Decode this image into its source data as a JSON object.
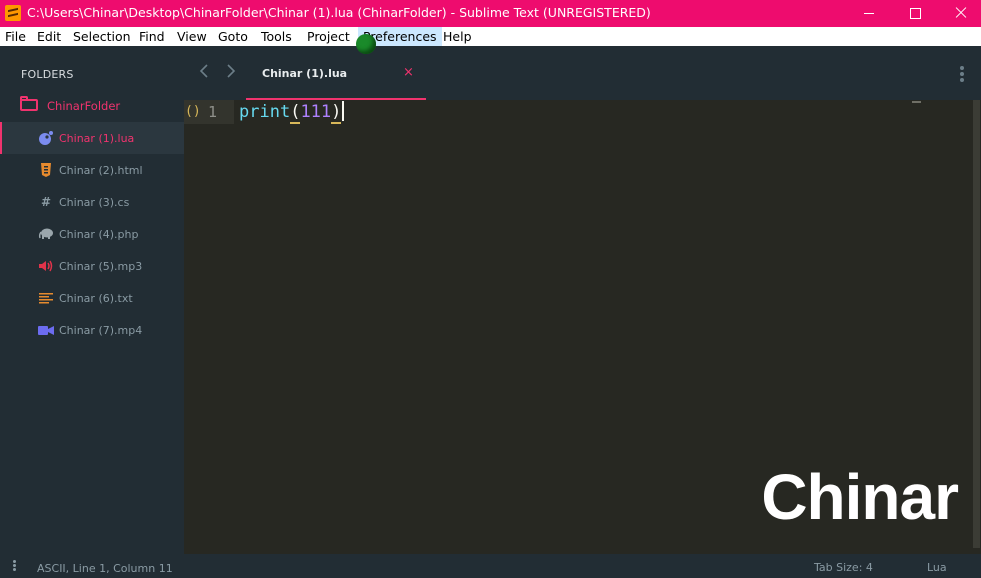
{
  "window": {
    "title": "C:\\Users\\Chinar\\Desktop\\ChinarFolder\\Chinar (1).lua (ChinarFolder) - Sublime Text (UNREGISTERED)"
  },
  "menu": [
    "File",
    "Edit",
    "Selection",
    "Find",
    "View",
    "Goto",
    "Tools",
    "Project",
    "Preferences",
    "Help"
  ],
  "sidebar": {
    "header": "FOLDERS",
    "folder": "ChinarFolder",
    "files": [
      {
        "label": "Chinar (1).lua",
        "icon": "lua-icon",
        "color": "#7b8cf0",
        "active": true
      },
      {
        "label": "Chinar (2).html",
        "icon": "html-icon",
        "color": "#e68a2e"
      },
      {
        "label": "Chinar (3).cs",
        "icon": "hash-icon",
        "color": "#8a9ba4"
      },
      {
        "label": "Chinar (4).php",
        "icon": "elephant-icon",
        "color": "#9aa6ac"
      },
      {
        "label": "Chinar (5).mp3",
        "icon": "speaker-icon",
        "color": "#e0334a"
      },
      {
        "label": "Chinar (6).txt",
        "icon": "text-lines-icon",
        "color": "#e68a2e"
      },
      {
        "label": "Chinar (7).mp4",
        "icon": "video-camera-icon",
        "color": "#6c6cf0"
      }
    ]
  },
  "tab": {
    "label": "Chinar (1).lua",
    "close": "×"
  },
  "editor": {
    "gutter_marker": "()",
    "line_number": "1",
    "code": {
      "fn": "print",
      "open": "(",
      "num": "111",
      "close": ")"
    }
  },
  "watermark": "Chinar",
  "status": {
    "position": "ASCII, Line 1, Column 11",
    "tab_size": "Tab Size: 4",
    "syntax": "Lua"
  },
  "colors": {
    "titlebar": "#ee0c6e",
    "accent": "#f0336e",
    "sidebar_bg": "#222d34",
    "editor_bg": "#272822"
  }
}
